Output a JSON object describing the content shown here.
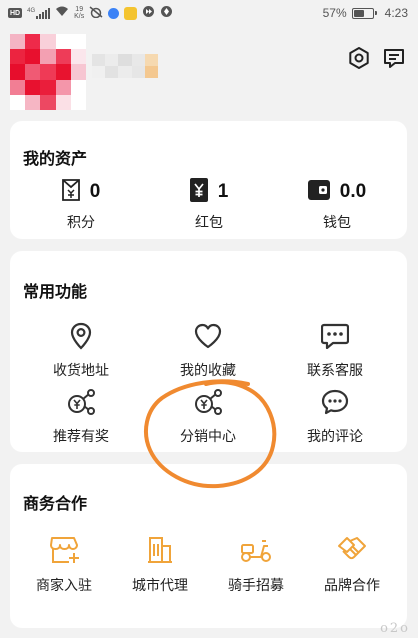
{
  "status_bar": {
    "network_left": "HD",
    "network_gen": "4G",
    "speed_value": "19",
    "speed_unit": "K/s",
    "battery_percent": "57%",
    "battery_level": 0.57,
    "time": "4:23"
  },
  "header": {
    "avatar_state": "pixelated",
    "settings_icon": "gear-icon",
    "message_icon": "chat-bubble-icon"
  },
  "assets": {
    "title": "我的资产",
    "items": [
      {
        "icon": "points-icon",
        "value": "0",
        "label": "积分"
      },
      {
        "icon": "red-packet-icon",
        "value": "1",
        "label": "红包"
      },
      {
        "icon": "wallet-icon",
        "value": "0.0",
        "label": "钱包"
      }
    ]
  },
  "functions": {
    "title": "常用功能",
    "items": [
      {
        "icon": "location-pin-icon",
        "label": "收货地址"
      },
      {
        "icon": "heart-icon",
        "label": "我的收藏"
      },
      {
        "icon": "customer-service-icon",
        "label": "联系客服"
      },
      {
        "icon": "share-yuan-icon",
        "label": "推荐有奖"
      },
      {
        "icon": "share-yuan-icon",
        "label": "分销中心"
      },
      {
        "icon": "comment-icon",
        "label": "我的评论"
      }
    ]
  },
  "business": {
    "title": "商务合作",
    "items": [
      {
        "icon": "store-add-icon",
        "label": "商家入驻"
      },
      {
        "icon": "city-building-icon",
        "label": "城市代理"
      },
      {
        "icon": "scooter-icon",
        "label": "骑手招募"
      },
      {
        "icon": "handshake-icon",
        "label": "品牌合作"
      }
    ]
  },
  "colors": {
    "accent": "#f0a43a",
    "annotation": "#f08a30",
    "icon_dark": "#333333",
    "background": "#f2f2f2"
  },
  "watermark": "o2o"
}
